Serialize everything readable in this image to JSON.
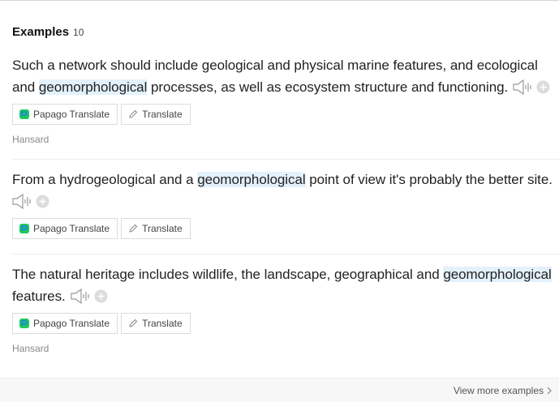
{
  "section": {
    "title": "Examples",
    "count": "10"
  },
  "examples": [
    {
      "before": "Such a network should include geological and physical marine features, and ecological and ",
      "highlight": "geomorphological",
      "after": " processes, as well as ecosystem structure and functioning.",
      "papago_label": "Papago Translate",
      "translate_label": "Translate",
      "source": "Hansard"
    },
    {
      "before": "From a hydrogeological and a ",
      "highlight": "geomorphological",
      "after": " point of view it's probably the better site.",
      "papago_label": "Papago Translate",
      "translate_label": "Translate",
      "source": ""
    },
    {
      "before": "The natural heritage includes wildlife, the landscape, geographical and ",
      "highlight": "geomorphological",
      "after": " features.",
      "papago_label": "Papago Translate",
      "translate_label": "Translate",
      "source": "Hansard"
    }
  ],
  "footer": {
    "more_label": "View more examples"
  },
  "colors": {
    "highlight": "#e3f1fc",
    "papago_green": "#1fc85b",
    "papago_blue": "#1a7ef2"
  },
  "icons": [
    "speaker-icon",
    "plus-circle-icon",
    "papago-logo-icon",
    "pencil-icon",
    "chevron-right-icon"
  ]
}
